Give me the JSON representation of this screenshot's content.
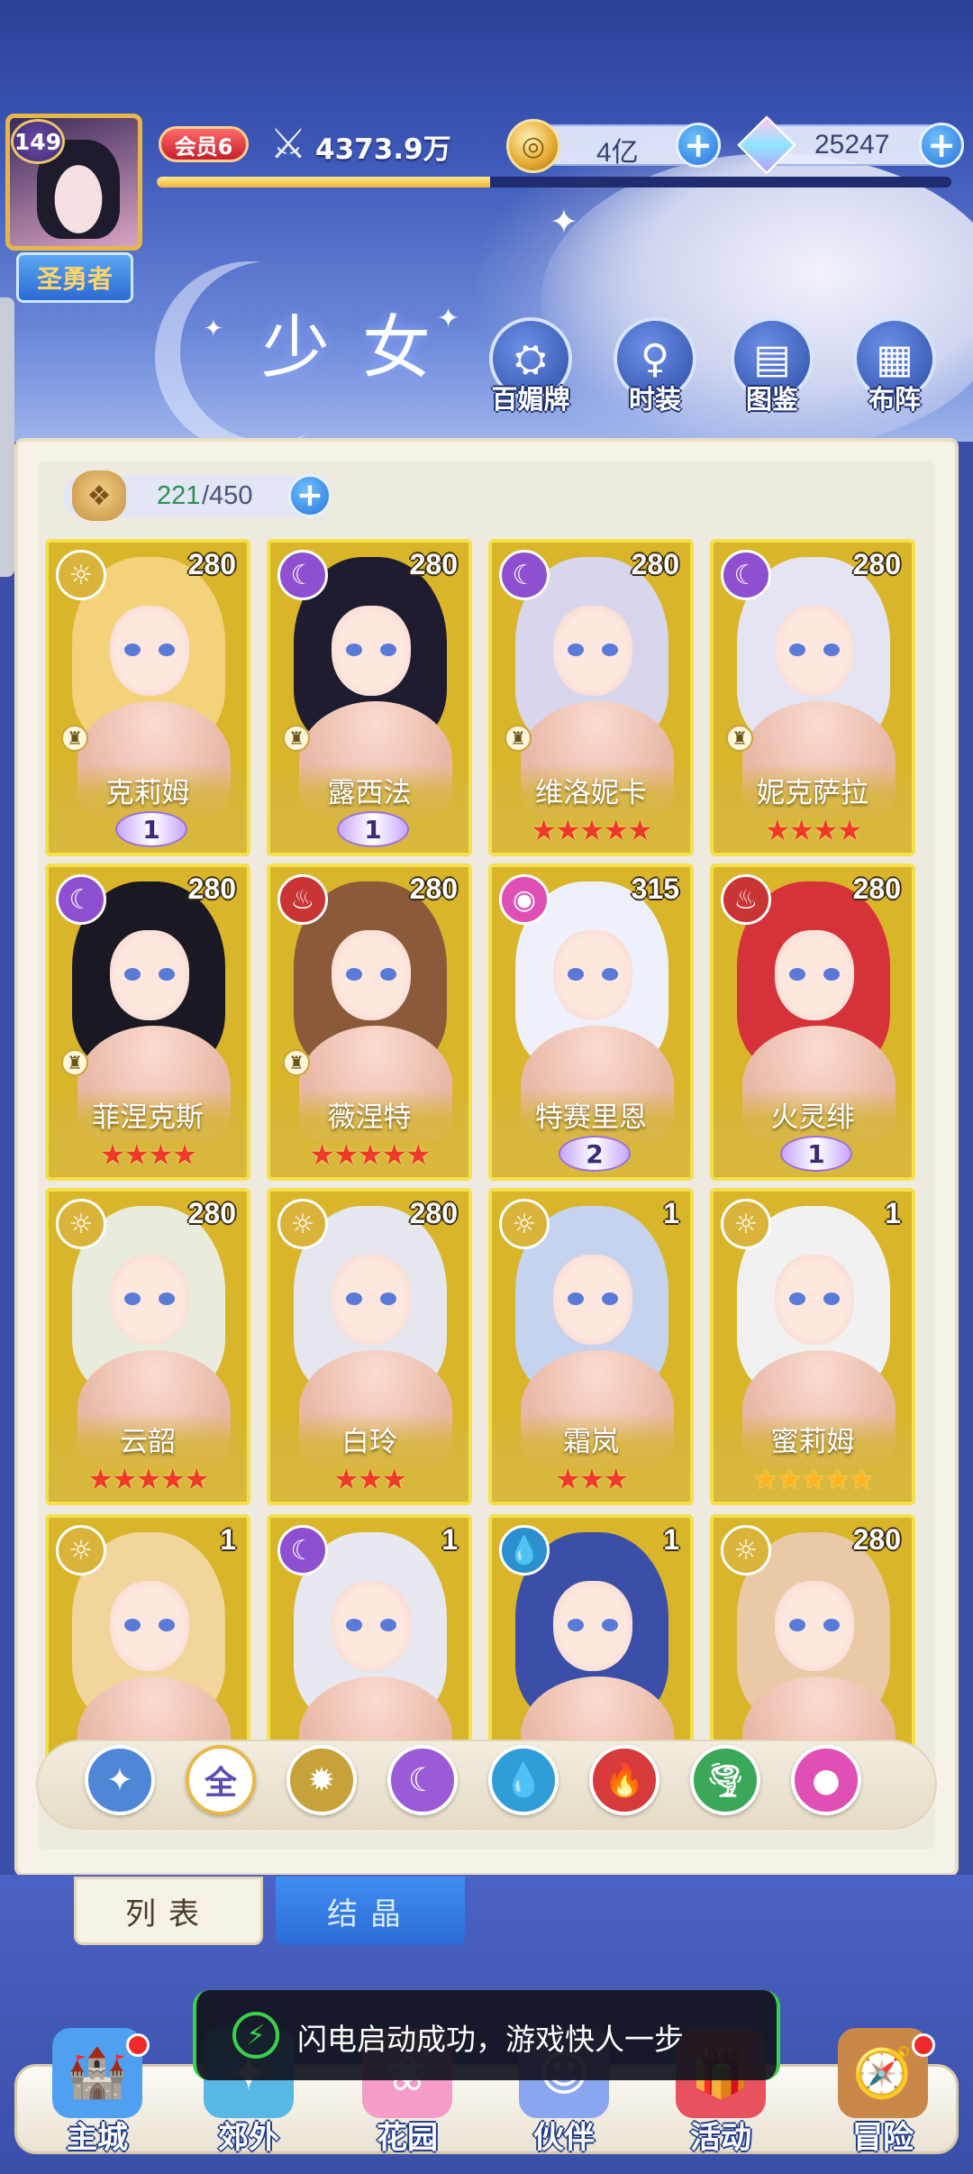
{
  "player": {
    "level": "149",
    "title": "圣勇者",
    "vip": "会员6",
    "power": "4373.9万",
    "exp_fraction": 0.42
  },
  "currencies": [
    {
      "name": "gold",
      "value": "4亿"
    },
    {
      "name": "diamond",
      "value": "25247"
    }
  ],
  "page_title": "少女",
  "top_buttons": [
    {
      "label": "百媚牌",
      "icon": "card-deck-icon"
    },
    {
      "label": "时装",
      "icon": "fashion-icon"
    },
    {
      "label": "图鉴",
      "icon": "codex-icon"
    },
    {
      "label": "布阵",
      "icon": "formation-icon"
    }
  ],
  "capacity": {
    "current": "221",
    "max": "/450"
  },
  "cards": [
    {
      "name": "克莉姆",
      "level": "280",
      "element": "light",
      "rank": "♜",
      "stars": 0,
      "wing": "1",
      "hair": "#f3d27a"
    },
    {
      "name": "露西法",
      "level": "280",
      "element": "moon",
      "rank": "♜",
      "stars": 0,
      "wing": "1",
      "hair": "#1f1c30"
    },
    {
      "name": "维洛妮卡",
      "level": "280",
      "element": "moon",
      "rank": "♜",
      "stars": 5,
      "wing": "",
      "hair": "#d8d6ec"
    },
    {
      "name": "妮克萨拉",
      "level": "280",
      "element": "moon",
      "rank": "♜",
      "stars": 4,
      "wing": "",
      "hair": "#e4e4f2"
    },
    {
      "name": "菲涅克斯",
      "level": "280",
      "element": "moon",
      "rank": "♜",
      "stars": 4,
      "wing": "",
      "hair": "#1a1822"
    },
    {
      "name": "薇涅特",
      "level": "280",
      "element": "fire",
      "rank": "♜",
      "stars": 5,
      "wing": "",
      "hair": "#8a5a3a"
    },
    {
      "name": "特赛里恩",
      "level": "315",
      "element": "astral",
      "rank": "",
      "stars": 0,
      "wing": "2",
      "hair": "#eef1fb"
    },
    {
      "name": "火灵绯",
      "level": "280",
      "element": "fire",
      "rank": "",
      "stars": 0,
      "wing": "1",
      "hair": "#d6323a"
    },
    {
      "name": "云韶",
      "level": "280",
      "element": "light",
      "rank": "",
      "stars": 5,
      "wing": "",
      "hair": "#e9ecdc"
    },
    {
      "name": "白玲",
      "level": "280",
      "element": "light",
      "rank": "",
      "stars": 3,
      "wing": "",
      "hair": "#e6e6ee"
    },
    {
      "name": "霜岚",
      "level": "1",
      "element": "light",
      "rank": "",
      "stars": 3,
      "wing": "",
      "hair": "#c6d3ef"
    },
    {
      "name": "蜜莉姆",
      "level": "1",
      "element": "light",
      "rank": "",
      "stars": 5,
      "wing": "",
      "hair": "#f1f1f1",
      "gold_stars": true
    },
    {
      "name": "",
      "level": "1",
      "element": "light",
      "rank": "",
      "stars": 0,
      "wing": "",
      "hair": "#f1d59a"
    },
    {
      "name": "",
      "level": "1",
      "element": "moon",
      "rank": "",
      "stars": 0,
      "wing": "",
      "hair": "#e8e8f0"
    },
    {
      "name": "",
      "level": "1",
      "element": "water",
      "rank": "",
      "stars": 0,
      "wing": "",
      "hair": "#3b4fa8"
    },
    {
      "name": "",
      "level": "280",
      "element": "light",
      "rank": "",
      "stars": 0,
      "wing": "",
      "hair": "#e9c9a6"
    }
  ],
  "filters": [
    {
      "name": "wind",
      "label": "",
      "glyph": "✦",
      "color": "#4f86d6"
    },
    {
      "name": "all",
      "label": "全",
      "glyph": "全",
      "color": "#ffffff"
    },
    {
      "name": "light",
      "label": "",
      "glyph": "✹",
      "color": "#c7a23a"
    },
    {
      "name": "moon",
      "label": "",
      "glyph": "☾",
      "color": "#9b5ad6"
    },
    {
      "name": "water",
      "label": "",
      "glyph": "💧",
      "color": "#2f9ed8"
    },
    {
      "name": "fire",
      "label": "",
      "glyph": "🔥",
      "color": "#d63a3a"
    },
    {
      "name": "nature",
      "label": "",
      "glyph": "🌪",
      "color": "#3aa858"
    },
    {
      "name": "astral",
      "label": "",
      "glyph": "●",
      "color": "#e04fb4"
    }
  ],
  "sub_tabs": {
    "list": "列表",
    "crystal": "结晶"
  },
  "toast": "闪电启动成功，游戏快人一步",
  "nav": [
    {
      "label": "主城",
      "icon": "castle-icon",
      "dot": true
    },
    {
      "label": "郊外",
      "icon": "map-icon",
      "dot": false
    },
    {
      "label": "花园",
      "icon": "garden-icon",
      "dot": false
    },
    {
      "label": "伙伴",
      "icon": "partner-icon",
      "dot": false
    },
    {
      "label": "活动",
      "icon": "gift-icon",
      "dot": false
    },
    {
      "label": "冒险",
      "icon": "compass-icon",
      "dot": true
    }
  ],
  "colors": {
    "card_gold": "#d9b52a",
    "star_red": "#ef3a2a",
    "accent_blue": "#2874da"
  }
}
